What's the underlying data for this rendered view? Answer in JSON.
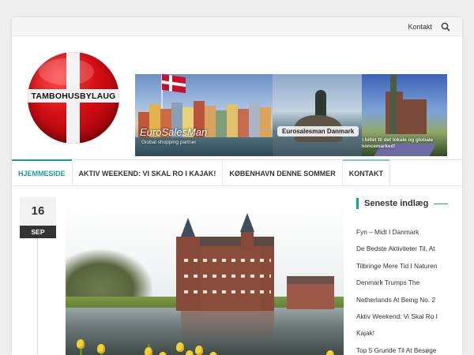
{
  "topbar": {
    "contact_label": "Kontakt",
    "search_icon": "search-icon"
  },
  "header": {
    "logo_text": "TAMBOHUSBYLAUG",
    "banner": {
      "left_brand": "EuroSalesMan",
      "left_tagline": "Global shopping partner",
      "middle_label": "Eurosalesman Danmark",
      "right_text": "Din billet til det lokale og globale annoncemarked!"
    }
  },
  "nav": {
    "items": [
      {
        "label": "HJEMMESIDE",
        "active": true,
        "accent": "#1c9c9c"
      },
      {
        "label": "AKTIV WEEKEND: VI SKAL RO I KAJAK!",
        "active": false,
        "accent": ""
      },
      {
        "label": "KØBENHAVN DENNE SOMMER",
        "active": false,
        "accent": ""
      },
      {
        "label": "KONTAKT",
        "active": false,
        "accent": "#7cc3e0"
      }
    ]
  },
  "post": {
    "date_day": "16",
    "date_month": "SEP"
  },
  "sidebar": {
    "title": "Seneste indlæg",
    "posts": [
      "Fyn – Midt I Danmark",
      "De Bedste Aktiviteter Til, At",
      "Tilbringe Mere Tid I Naturen",
      "Denmark Trumps The",
      "Netherlands At Being No. 2",
      "Aktiv Weekend: Vi Skal Ro I",
      "Kajak!",
      "Top 5 Grunde Til At Besøge"
    ]
  },
  "colors": {
    "accent": "#1c9c9c",
    "dark": "#333333",
    "logo_red": "#d40f15"
  }
}
